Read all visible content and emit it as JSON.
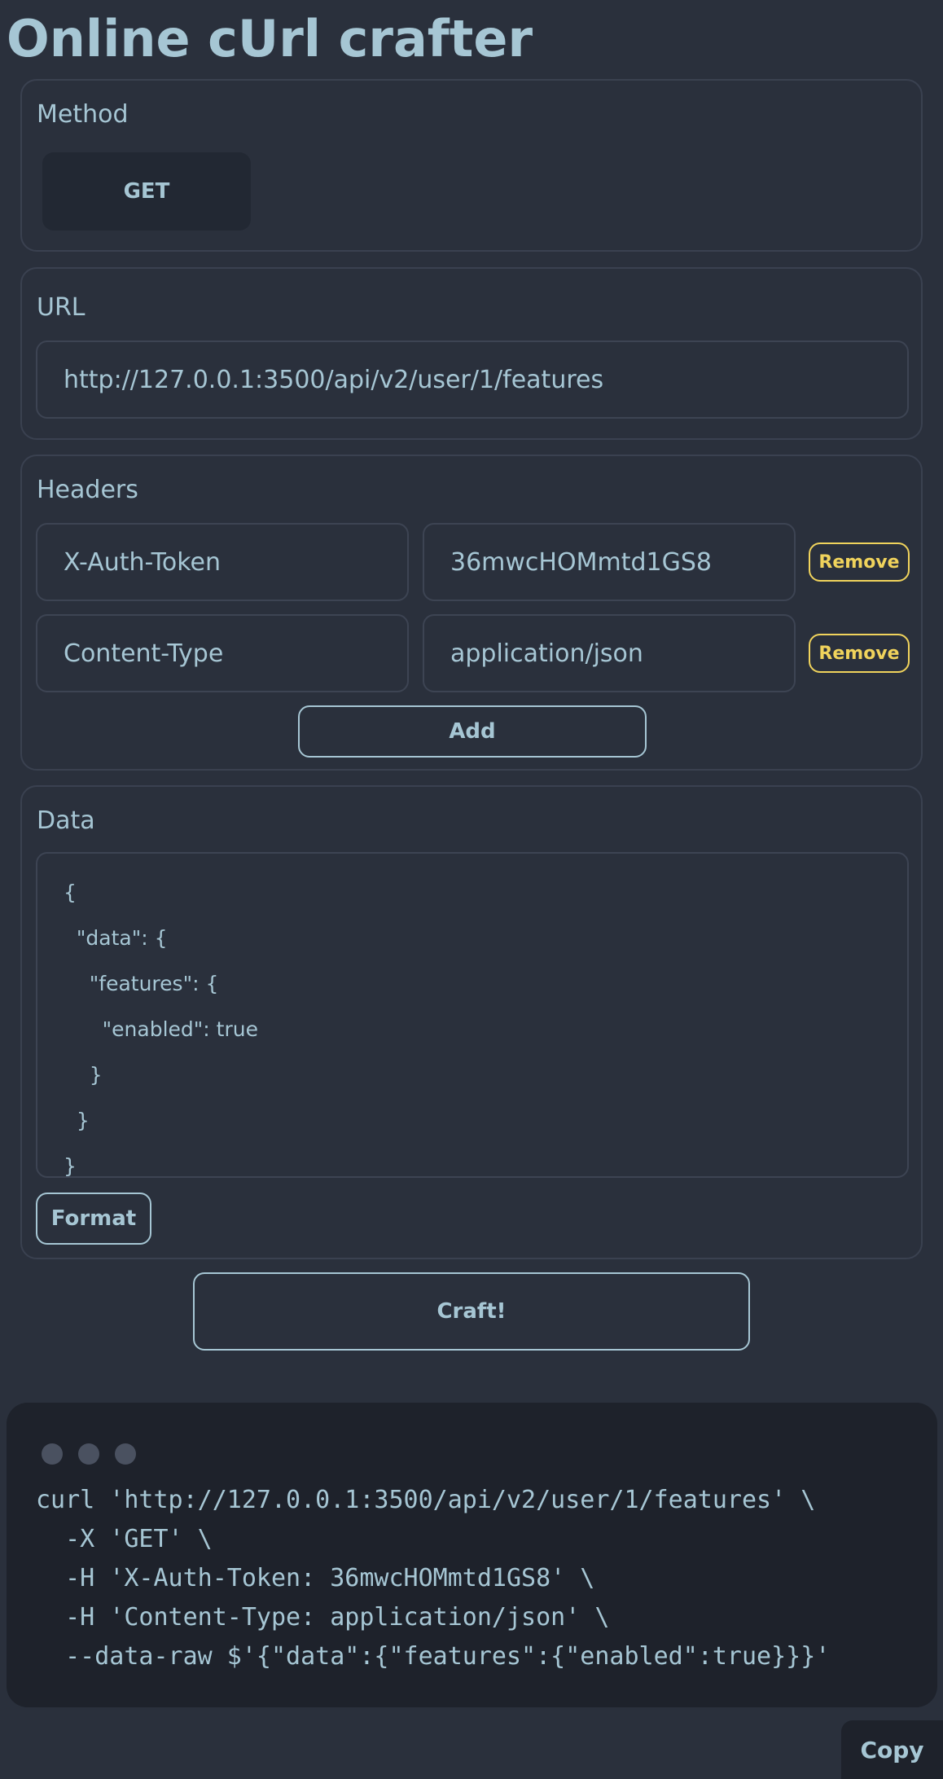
{
  "title": "Online cUrl crafter",
  "method": {
    "label": "Method",
    "value": "GET"
  },
  "url": {
    "label": "URL",
    "value": "http://127.0.0.1:3500/api/v2/user/1/features"
  },
  "headers": {
    "label": "Headers",
    "rows": [
      {
        "key": "X-Auth-Token",
        "value": "36mwcHOMmtd1GS8",
        "remove": "Remove"
      },
      {
        "key": "Content-Type",
        "value": "application/json",
        "remove": "Remove"
      }
    ],
    "add_label": "Add"
  },
  "data": {
    "label": "Data",
    "lines": [
      "{",
      "  \"data\": {",
      "    \"features\": {",
      "      \"enabled\": true",
      "    }",
      "  }",
      "}"
    ],
    "format_label": "Format"
  },
  "craft_label": "Craft!",
  "output": {
    "lines": [
      "curl 'http://127.0.0.1:3500/api/v2/user/1/features' \\",
      "  -X 'GET' \\",
      "  -H 'X-Auth-Token: 36mwcHOMmtd1GS8' \\",
      "  -H 'Content-Type: application/json' \\",
      "  --data-raw $'{\"data\":{\"features\":{\"enabled\":true}}}'"
    ],
    "copy_label": "Copy"
  }
}
